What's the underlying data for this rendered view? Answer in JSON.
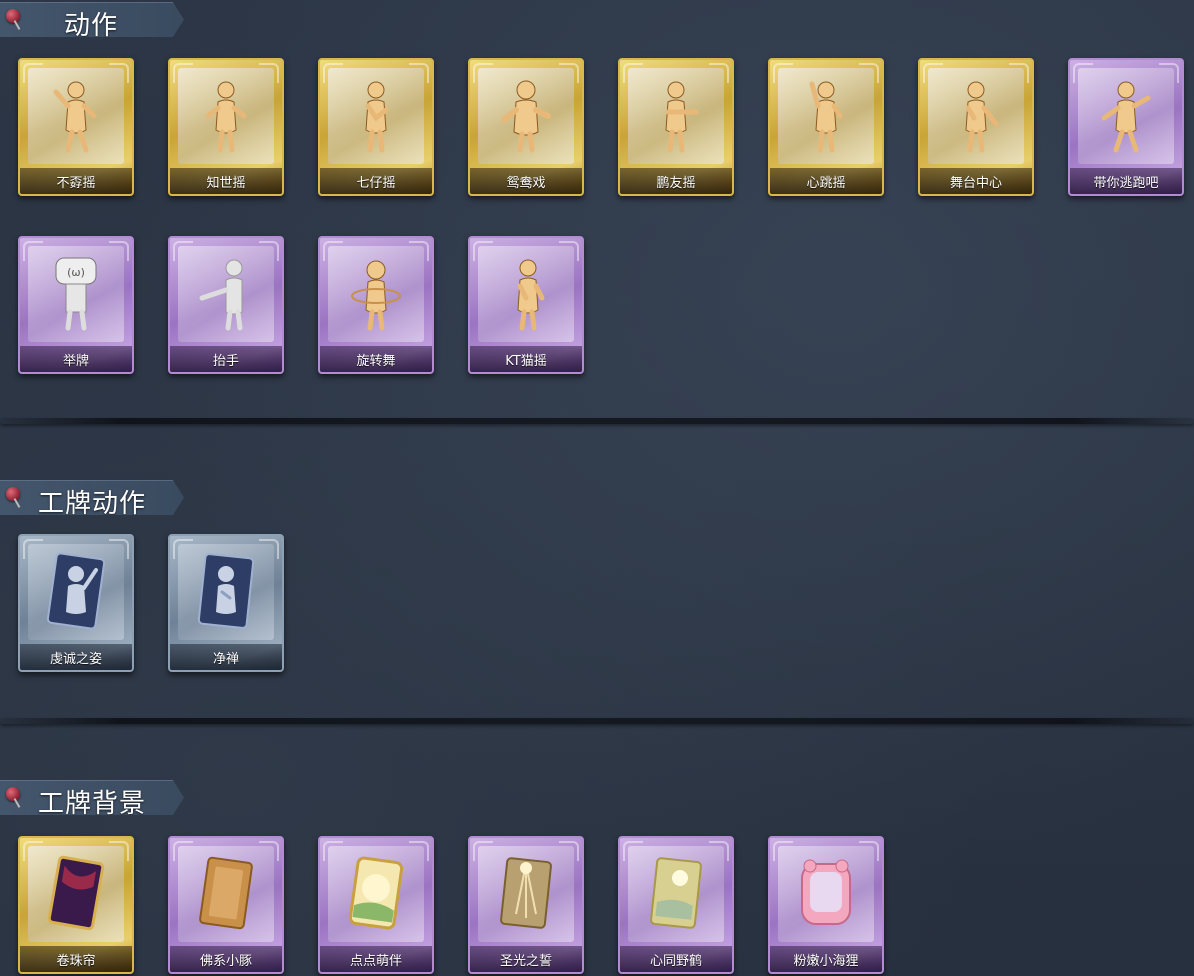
{
  "sections": {
    "actions": {
      "title": "动作",
      "items": [
        {
          "label": "不孬摇",
          "rarity": "gold"
        },
        {
          "label": "知世摇",
          "rarity": "gold"
        },
        {
          "label": "七仔摇",
          "rarity": "gold"
        },
        {
          "label": "鸳鸯戏",
          "rarity": "gold"
        },
        {
          "label": "鹏友摇",
          "rarity": "gold"
        },
        {
          "label": "心跳摇",
          "rarity": "gold"
        },
        {
          "label": "舞台中心",
          "rarity": "gold"
        },
        {
          "label": "带你逃跑吧",
          "rarity": "purple"
        },
        {
          "label": "举牌",
          "rarity": "purple"
        },
        {
          "label": "抬手",
          "rarity": "purple"
        },
        {
          "label": "旋转舞",
          "rarity": "purple"
        },
        {
          "label": "KT猫摇",
          "rarity": "purple"
        }
      ]
    },
    "badge_actions": {
      "title": "工牌动作",
      "items": [
        {
          "label": "虔诚之姿",
          "rarity": "blue"
        },
        {
          "label": "净禅",
          "rarity": "blue"
        }
      ]
    },
    "badge_backgrounds": {
      "title": "工牌背景",
      "items": [
        {
          "label": "卷珠帘",
          "rarity": "gold"
        },
        {
          "label": "佛系小豚",
          "rarity": "purple"
        },
        {
          "label": "点点萌伴",
          "rarity": "purple"
        },
        {
          "label": "圣光之誓",
          "rarity": "purple"
        },
        {
          "label": "心同野鹤",
          "rarity": "purple"
        },
        {
          "label": "粉嫩小海狸",
          "rarity": "purple"
        }
      ]
    }
  },
  "colors": {
    "gold": "#d8b84c",
    "purple": "#b28bd3",
    "blue": "#8ea0b4",
    "background": "#2b3544"
  },
  "icons": {
    "figure": "dancing-figure-icon",
    "pin": "pin-icon"
  }
}
